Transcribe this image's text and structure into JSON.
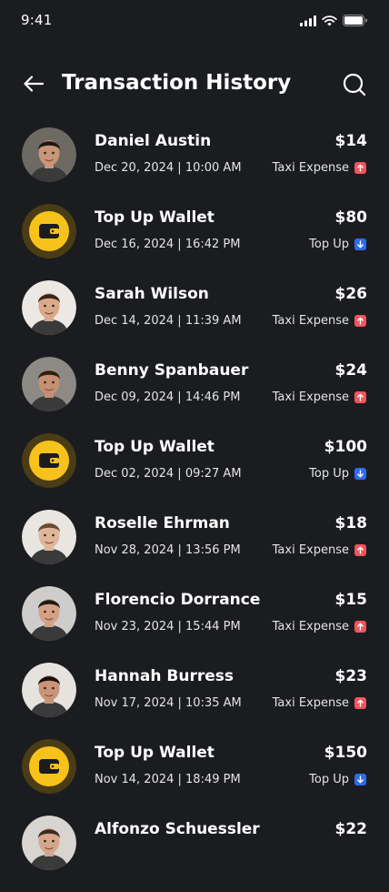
{
  "status_bar": {
    "time": "9:41"
  },
  "header": {
    "title": "Transaction History"
  },
  "colors": {
    "background": "#1b1c20",
    "wallet_yellow": "#f7c21c",
    "wallet_ring": "#4a3c14",
    "expense_red": "#f2545b",
    "topup_blue": "#2e6bf0"
  },
  "transactions": [
    {
      "name": "Daniel Austin",
      "date": "Dec 20, 2024 | 10:00 AM",
      "amount": "$14",
      "type": "Taxi Expense",
      "direction": "up",
      "avatar": "person",
      "avatar_bg": "#6d6a64",
      "skin": "#c99578",
      "hair": "#1e1712"
    },
    {
      "name": "Top Up Wallet",
      "date": "Dec 16, 2024 | 16:42 PM",
      "amount": "$80",
      "type": "Top Up",
      "direction": "down",
      "avatar": "wallet-icon"
    },
    {
      "name": "Sarah Wilson",
      "date": "Dec 14, 2024 | 11:39 AM",
      "amount": "$26",
      "type": "Taxi Expense",
      "direction": "up",
      "avatar": "person",
      "avatar_bg": "#ece8e4",
      "skin": "#d9a98a",
      "hair": "#3a2518"
    },
    {
      "name": "Benny Spanbauer",
      "date": "Dec 09, 2024 | 14:46 PM",
      "amount": "$24",
      "type": "Taxi Expense",
      "direction": "up",
      "avatar": "person",
      "avatar_bg": "#8d8a86",
      "skin": "#c58f73",
      "hair": "#2b2019"
    },
    {
      "name": "Top Up Wallet",
      "date": "Dec 02, 2024 | 09:27 AM",
      "amount": "$100",
      "type": "Top Up",
      "direction": "down",
      "avatar": "wallet-icon"
    },
    {
      "name": "Roselle Ehrman",
      "date": "Nov 28, 2024 | 13:56 PM",
      "amount": "$18",
      "type": "Taxi Expense",
      "direction": "up",
      "avatar": "person",
      "avatar_bg": "#e9e6e2",
      "skin": "#e0b69b",
      "hair": "#6b4a34"
    },
    {
      "name": "Florencio Dorrance",
      "date": "Nov 23, 2024 | 15:44 PM",
      "amount": "$15",
      "type": "Taxi Expense",
      "direction": "up",
      "avatar": "person",
      "avatar_bg": "#cfcdcb",
      "skin": "#d3a286",
      "hair": "#1f1a17"
    },
    {
      "name": "Hannah Burress",
      "date": "Nov 17, 2024 | 10:35 AM",
      "amount": "$23",
      "type": "Taxi Expense",
      "direction": "up",
      "avatar": "person",
      "avatar_bg": "#e6e3df",
      "skin": "#c99477",
      "hair": "#15100d"
    },
    {
      "name": "Top Up Wallet",
      "date": "Nov 14, 2024 | 18:49 PM",
      "amount": "$150",
      "type": "Top Up",
      "direction": "down",
      "avatar": "wallet-icon"
    },
    {
      "name": "Alfonzo Schuessler",
      "date": "",
      "amount": "$22",
      "type": "",
      "direction": "",
      "avatar": "person",
      "avatar_bg": "#d8d4d0",
      "skin": "#d4a68c",
      "hair": "#3b2a1f"
    }
  ]
}
